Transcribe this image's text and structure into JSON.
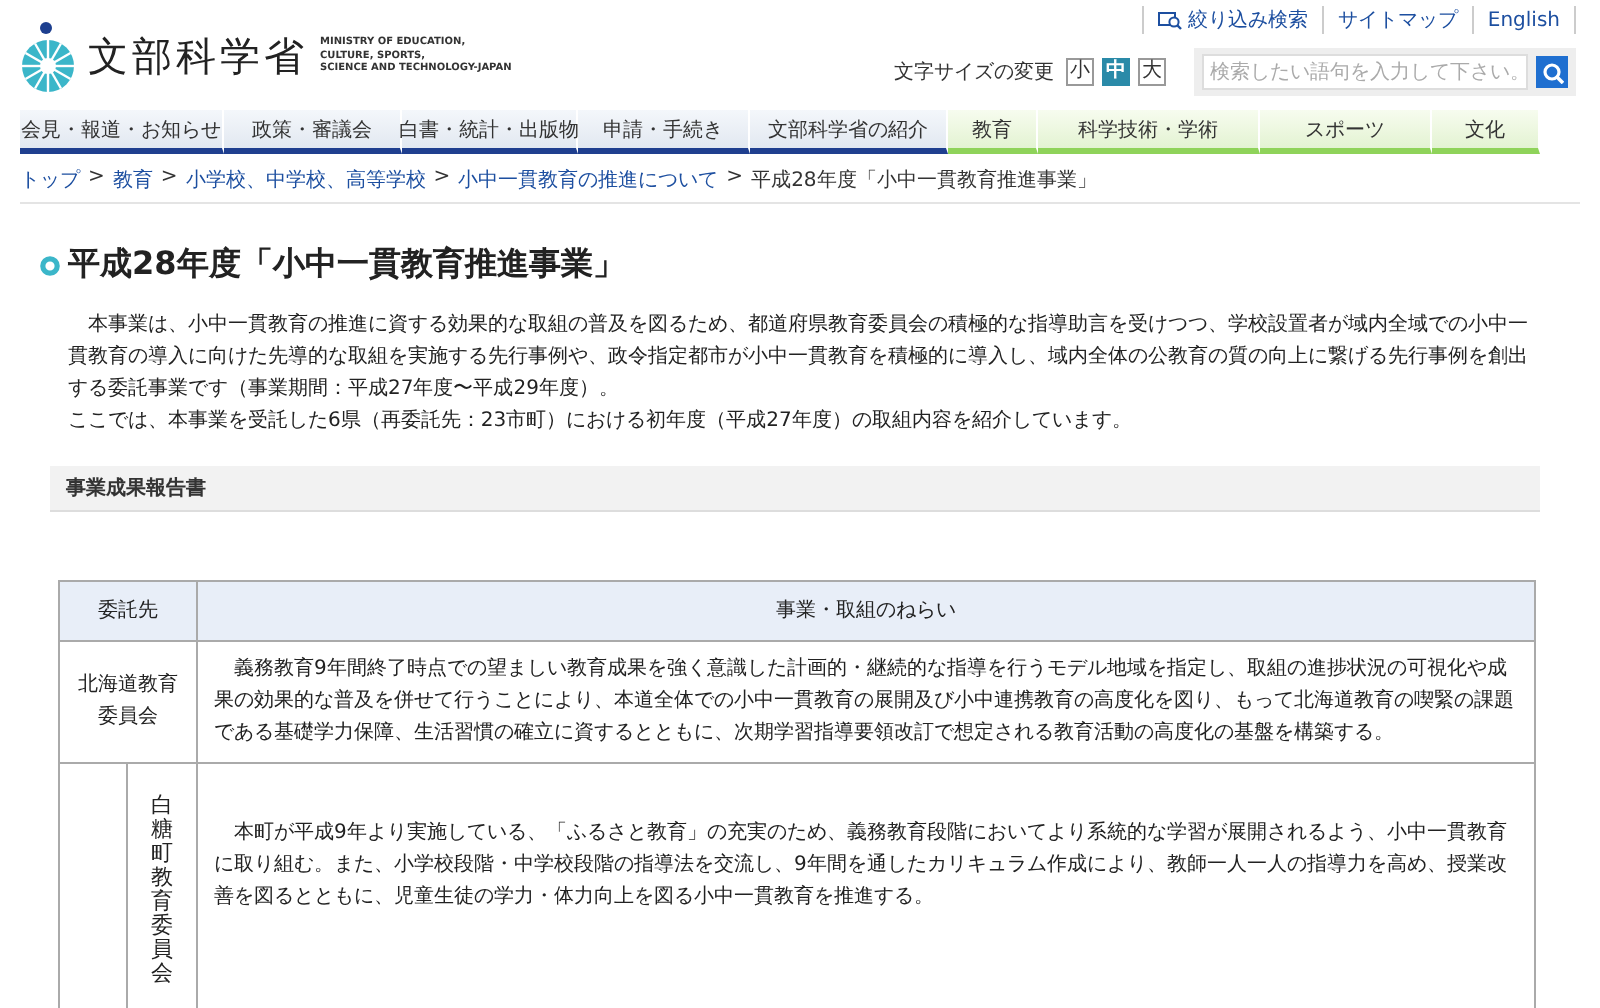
{
  "header": {
    "logo": {
      "name": "文部科学省",
      "english": [
        "MINISTRY OF EDUCATION,",
        "CULTURE, SPORTS,",
        "SCIENCE AND TECHNOLOGY-JAPAN"
      ]
    },
    "top_links": [
      "絞り込み検索",
      "サイトマップ",
      "English"
    ],
    "font_size": {
      "label": "文字サイズの変更",
      "options": [
        {
          "label": "小",
          "selected": false
        },
        {
          "label": "中",
          "selected": true
        },
        {
          "label": "大",
          "selected": false
        }
      ]
    },
    "search": {
      "placeholder": "検索したい語句を入力して下さい。"
    }
  },
  "nav": [
    {
      "label": "会見・報道・お知らせ",
      "color": "#1f3f8f"
    },
    {
      "label": "政策・審議会",
      "color": "#1f3f8f"
    },
    {
      "label": "白書・統計・出版物",
      "color": "#1f3f8f"
    },
    {
      "label": "申請・手続き",
      "color": "#1f3f8f"
    },
    {
      "label": "文部科学省の紹介",
      "color": "#1f3f8f"
    },
    {
      "label": "教育",
      "color": "#8fd35a"
    },
    {
      "label": "科学技術・学術",
      "color": "#8fd35a"
    },
    {
      "label": "スポーツ",
      "color": "#8fd35a"
    },
    {
      "label": "文化",
      "color": "#8fd35a"
    }
  ],
  "breadcrumb": {
    "separator": ">",
    "items": [
      {
        "label": "トップ",
        "link": true
      },
      {
        "label": "教育",
        "link": true
      },
      {
        "label": "小学校、中学校、高等学校",
        "link": true
      },
      {
        "label": "小中一貫教育の推進について",
        "link": true
      },
      {
        "label": "平成28年度「小中一貫教育推進事業」",
        "link": false
      }
    ]
  },
  "page_title": "平成28年度「小中一貫教育推進事業」",
  "paragraphs": [
    "本事業は、小中一貫教育の推進に資する効果的な取組の普及を図るため、都道府県教育委員会の積極的な指導助言を受けつつ、学校設置者が域内全域での小中一貫教育の導入に向けた先導的な取組を実施する先行事例や、政令指定都市が小中一貫教育を積極的に導入し、域内全体の公教育の質の向上に繋げる先行事例を創出する委託事業です（事業期間：平成27年度〜平成29年度）。",
    "ここでは、本事業を受託した6県（再委託先：23市町）における初年度（平成27年度）の取組内容を紹介しています。"
  ],
  "section_heading": "事業成果報告書",
  "table": {
    "columns": [
      "委託先",
      "事業・取組のねらい"
    ],
    "rows": [
      {
        "entity": "北海道教育委員会",
        "text": "義務教育9年間終了時点での望ましい教育成果を強く意識した計画的・継続的な指導を行うモデル地域を指定し、取組の進捗状況の可視化や成果の効果的な普及を併せて行うことにより、本道全体での小中一貫教育の展開及び小中連携教育の高度化を図り、もって北海道教育の喫緊の課題である基礎学力保障、生活習慣の確立に資するとともに、次期学習指導要領改訂で想定される教育活動の高度化の基盤を構築する。",
        "children": [
          {
            "entity": "白糖町教育委員会",
            "text": "本町が平成9年より実施している、「ふるさと教育」の充実のため、義務教育段階においてより系統的な学習が展開されるよう、小中一貫教育に取り組む。また、小学校段階・中学校段階の指導法を交流し、9年間を通したカリキュラム作成により、教師一人一人の指導力を高め、授業改善を図るとともに、児童生徒の学力・体力向上を図る小中一貫教育を推進する。"
          }
        ]
      }
    ]
  }
}
